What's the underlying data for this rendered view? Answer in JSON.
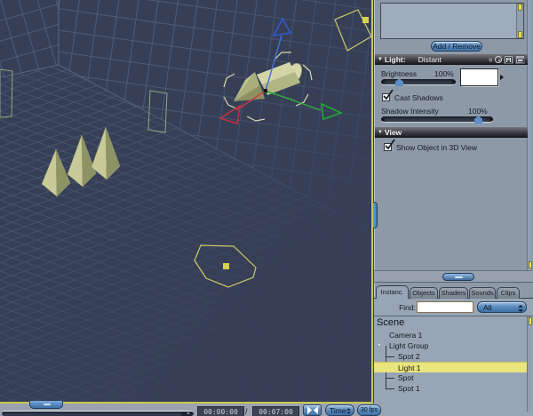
{
  "properties_panel": {
    "modifier_list_items": [],
    "add_remove_button": "Add / Remove",
    "light_section": {
      "title": "Light:",
      "type": "Distant",
      "brightness": {
        "label": "Brightness",
        "value": "100%",
        "percent": 100
      },
      "cast_shadows": {
        "label": "Cast Shadows",
        "checked": true
      },
      "shadow_intensity": {
        "label": "Shadow Intensity",
        "value": "100%",
        "percent": 100
      }
    },
    "view_section": {
      "title": "View",
      "show_object": {
        "label": "Show Object in 3D View",
        "checked": true
      }
    }
  },
  "browser_panel": {
    "tabs": [
      "Instanc.",
      "Objects",
      "Shaders",
      "Sounds",
      "Clips"
    ],
    "active_tab": "Instanc.",
    "find_label": "Find:",
    "find_value": "",
    "filter_value": "All",
    "scene_title": "Scene",
    "tree": [
      {
        "label": "Camera 1",
        "level": 1,
        "selected": false
      },
      {
        "label": "Light Group",
        "level": 1,
        "expanded": true,
        "selected": false
      },
      {
        "label": "Spot 2",
        "level": 2,
        "selected": false
      },
      {
        "label": "Light 1",
        "level": 2,
        "selected": true
      },
      {
        "label": "Spot",
        "level": 2,
        "selected": false
      },
      {
        "label": "Spot 1",
        "level": 2,
        "selected": false
      }
    ]
  },
  "timeline": {
    "current_time": "00:00:00",
    "separator": "/",
    "end_time": "00:07:00",
    "time_mode": "Time",
    "frame_rate": "30 fps"
  },
  "icons": {
    "section_collapse": "▼",
    "tree_expanded": "▼",
    "more_chevron": "»"
  },
  "colors": {
    "viewport_bg": "#363f56",
    "grid_line": "#4f5b78",
    "panel_bg": "#8e99a8",
    "selection_border_yellow": "#c9c554",
    "scroll_cap_yellow": "#e9e44e",
    "row_highlight_yellow": "#eae57d",
    "accent_blue": "#5d8ec6",
    "object_khaki": "#c6c997",
    "axis_x_red": "#cf3648",
    "axis_y_green": "#2fae3f",
    "axis_z_blue": "#3f74de"
  }
}
